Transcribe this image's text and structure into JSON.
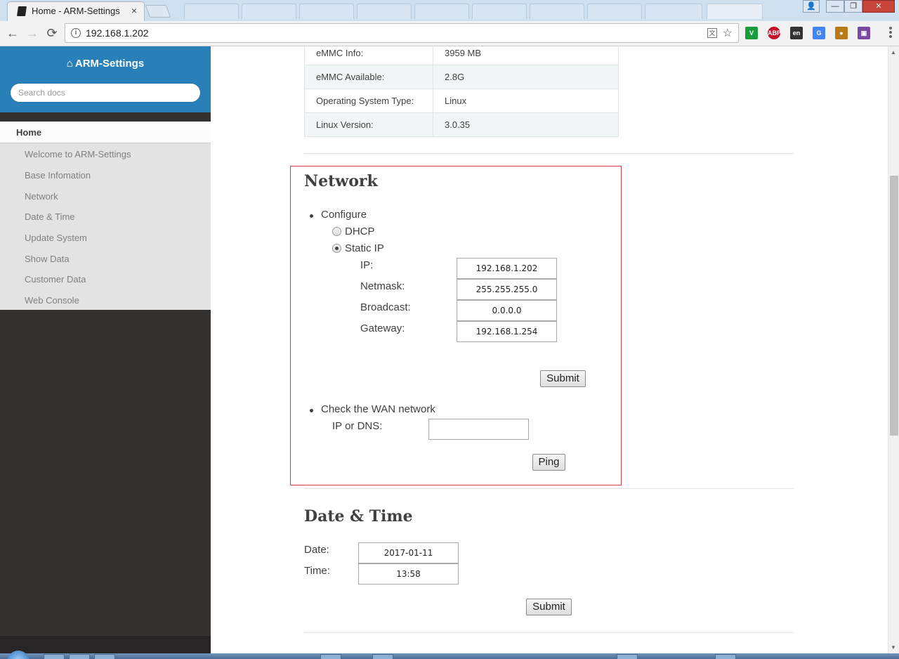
{
  "browser": {
    "tab_title": "Home - ARM-Settings",
    "tab_close": "×",
    "url": "192.168.1.202",
    "back": "←",
    "forward": "→",
    "reload": "⟳",
    "star": "☆",
    "info": "i",
    "translate": "文",
    "extensions": [
      {
        "name": "v-extension-icon",
        "label": "V",
        "color": "#1a9c3a"
      },
      {
        "name": "adblock-plus-icon",
        "label": "ABP",
        "color": "#c70d2c"
      },
      {
        "name": "en-extension-icon",
        "label": "en",
        "color": "#333333"
      },
      {
        "name": "google-translate-icon",
        "label": "G",
        "color": "#4285f4"
      },
      {
        "name": "orange-extension-icon",
        "label": "●",
        "color": "#b97a1a"
      },
      {
        "name": "screen-capture-icon",
        "label": "▣",
        "color": "#7a4aa0"
      }
    ],
    "window_buttons": {
      "user": "👤",
      "minimize": "—",
      "maximize": "❐",
      "close": "✕"
    }
  },
  "sidebar": {
    "home_icon": "⌂",
    "title": "ARM-Settings",
    "search_placeholder": "Search docs",
    "current": "Home",
    "items": [
      {
        "label": "Welcome to ARM-Settings"
      },
      {
        "label": "Base Infomation"
      },
      {
        "label": "Network"
      },
      {
        "label": "Date & Time"
      },
      {
        "label": "Update System"
      },
      {
        "label": "Show Data"
      },
      {
        "label": "Customer Data"
      },
      {
        "label": "Web Console"
      }
    ]
  },
  "info_table": {
    "rows": [
      {
        "key": "eMMC Info:",
        "value": "3959 MB"
      },
      {
        "key": "eMMC Available:",
        "value": "2.8G"
      },
      {
        "key": "Operating System Type:",
        "value": "Linux"
      },
      {
        "key": "Linux Version:",
        "value": "3.0.35"
      }
    ]
  },
  "network": {
    "heading": "Network",
    "configure_label": "Configure",
    "dhcp_label": "DHCP",
    "static_label": "Static IP",
    "dhcp_checked": false,
    "static_checked": true,
    "ip_label": "IP:",
    "ip_value": "192.168.1.202",
    "netmask_label": "Netmask:",
    "netmask_value": "255.255.255.0",
    "broadcast_label": "Broadcast:",
    "broadcast_value": "0.0.0.0",
    "gateway_label": "Gateway:",
    "gateway_value": "192.168.1.254",
    "submit_label": "Submit",
    "wan_label": "Check the WAN network",
    "ip_dns_label": "IP or DNS:",
    "ip_dns_value": "",
    "ping_label": "Ping"
  },
  "datetime": {
    "heading": "Date & Time",
    "date_label": "Date:",
    "date_value": "2017-01-11",
    "time_label": "Time:",
    "time_value": "13:58",
    "submit_label": "Submit"
  },
  "scrollbar": {
    "up": "▲",
    "down": "▼"
  }
}
